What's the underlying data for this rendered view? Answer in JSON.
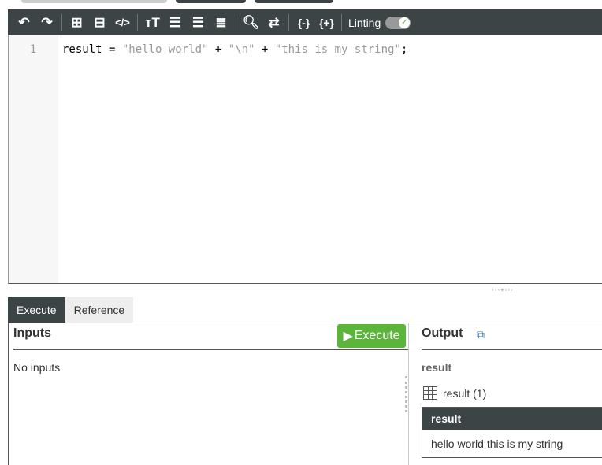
{
  "toolbar": {
    "icons": [
      "undo-icon",
      "redo-icon",
      "add-comment-icon",
      "remove-comment-icon",
      "code-tag-icon",
      "text-size-icon",
      "outdent-icon",
      "indent-icon",
      "align-icon",
      "search-icon",
      "replace-icon",
      "collapse-braces-icon",
      "expand-braces-icon"
    ],
    "linting_label": "Linting",
    "linting_on": true
  },
  "editor": {
    "line_numbers": [
      "1"
    ],
    "code": {
      "var": "result = ",
      "s1": "\"hello world\"",
      "p1": " + ",
      "s2": "\"\\n\"",
      "p2": " + ",
      "s3": "\"this is my string\"",
      "end": ";"
    }
  },
  "tabs": [
    "Execute",
    "Reference"
  ],
  "inputs": {
    "title": "Inputs",
    "execute_label": "Execute",
    "empty": "No inputs"
  },
  "output": {
    "title": "Output",
    "result_label": "result",
    "table_label": "result (1)",
    "table": {
      "header": "result",
      "rows": [
        "hello world this is my string"
      ]
    }
  }
}
